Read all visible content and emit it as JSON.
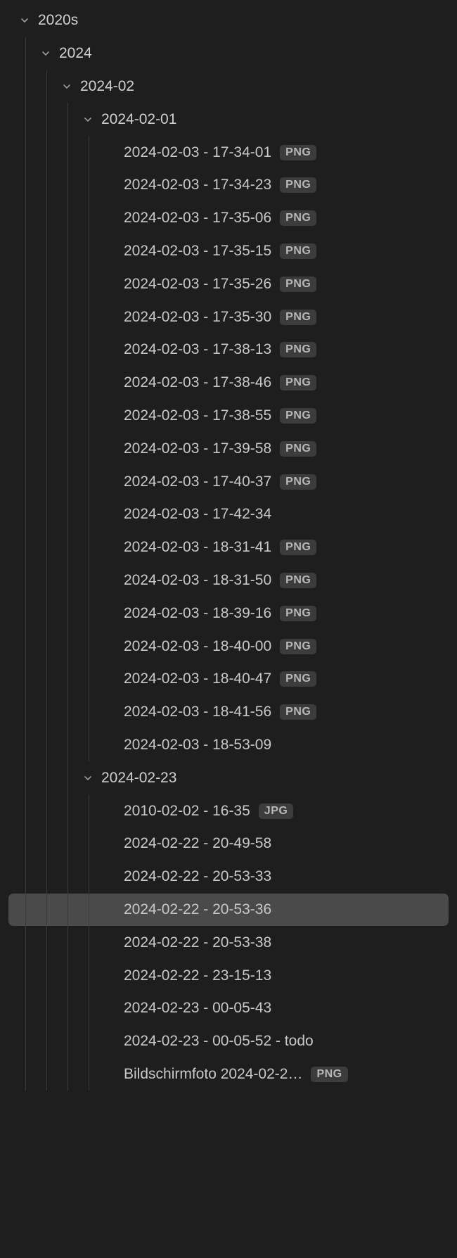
{
  "tree": [
    {
      "type": "folder",
      "depth": 0,
      "label": "2020s"
    },
    {
      "type": "folder",
      "depth": 1,
      "label": "2024"
    },
    {
      "type": "folder",
      "depth": 2,
      "label": "2024-02"
    },
    {
      "type": "folder",
      "depth": 3,
      "label": "2024-02-01"
    },
    {
      "type": "file",
      "depth": 4,
      "label": "2024-02-03 - 17-34-01",
      "badge": "PNG"
    },
    {
      "type": "file",
      "depth": 4,
      "label": "2024-02-03 - 17-34-23",
      "badge": "PNG"
    },
    {
      "type": "file",
      "depth": 4,
      "label": "2024-02-03 - 17-35-06",
      "badge": "PNG"
    },
    {
      "type": "file",
      "depth": 4,
      "label": "2024-02-03 - 17-35-15",
      "badge": "PNG"
    },
    {
      "type": "file",
      "depth": 4,
      "label": "2024-02-03 - 17-35-26",
      "badge": "PNG"
    },
    {
      "type": "file",
      "depth": 4,
      "label": "2024-02-03 - 17-35-30",
      "badge": "PNG"
    },
    {
      "type": "file",
      "depth": 4,
      "label": "2024-02-03 - 17-38-13",
      "badge": "PNG"
    },
    {
      "type": "file",
      "depth": 4,
      "label": "2024-02-03 - 17-38-46",
      "badge": "PNG"
    },
    {
      "type": "file",
      "depth": 4,
      "label": "2024-02-03 - 17-38-55",
      "badge": "PNG"
    },
    {
      "type": "file",
      "depth": 4,
      "label": "2024-02-03 - 17-39-58",
      "badge": "PNG"
    },
    {
      "type": "file",
      "depth": 4,
      "label": "2024-02-03 - 17-40-37",
      "badge": "PNG"
    },
    {
      "type": "file",
      "depth": 4,
      "label": "2024-02-03 - 17-42-34"
    },
    {
      "type": "file",
      "depth": 4,
      "label": "2024-02-03 - 18-31-41",
      "badge": "PNG"
    },
    {
      "type": "file",
      "depth": 4,
      "label": "2024-02-03 - 18-31-50",
      "badge": "PNG"
    },
    {
      "type": "file",
      "depth": 4,
      "label": "2024-02-03 - 18-39-16",
      "badge": "PNG"
    },
    {
      "type": "file",
      "depth": 4,
      "label": "2024-02-03 - 18-40-00",
      "badge": "PNG"
    },
    {
      "type": "file",
      "depth": 4,
      "label": "2024-02-03 - 18-40-47",
      "badge": "PNG"
    },
    {
      "type": "file",
      "depth": 4,
      "label": "2024-02-03 - 18-41-56",
      "badge": "PNG"
    },
    {
      "type": "file",
      "depth": 4,
      "label": "2024-02-03 - 18-53-09"
    },
    {
      "type": "folder",
      "depth": 3,
      "label": "2024-02-23"
    },
    {
      "type": "file",
      "depth": 4,
      "label": "2010-02-02 - 16-35",
      "badge": "JPG"
    },
    {
      "type": "file",
      "depth": 4,
      "label": "2024-02-22 - 20-49-58"
    },
    {
      "type": "file",
      "depth": 4,
      "label": "2024-02-22 - 20-53-33"
    },
    {
      "type": "file",
      "depth": 4,
      "label": "2024-02-22 - 20-53-36",
      "selected": true
    },
    {
      "type": "file",
      "depth": 4,
      "label": "2024-02-22 - 20-53-38"
    },
    {
      "type": "file",
      "depth": 4,
      "label": "2024-02-22 - 23-15-13"
    },
    {
      "type": "file",
      "depth": 4,
      "label": "2024-02-23 - 00-05-43"
    },
    {
      "type": "file",
      "depth": 4,
      "label": "2024-02-23 - 00-05-52 - todo"
    },
    {
      "type": "file",
      "depth": 4,
      "label": "Bildschirmfoto 2024-02-2…",
      "badge": "PNG"
    }
  ],
  "indent": {
    "base": 26,
    "step": 30,
    "file_extra": 30
  }
}
